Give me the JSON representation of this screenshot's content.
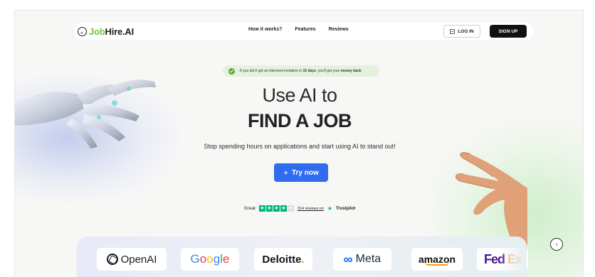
{
  "navbar": {
    "logo_prefix": "Job",
    "logo_suffix": "Hire.AI",
    "links": [
      "How it works?",
      "Features",
      "Reviews"
    ],
    "login_label": "LOG IN",
    "signup_label": "SIGN UP"
  },
  "badge": {
    "text_before": "If you don't get an interview invitation in ",
    "highlight_days": "15 days",
    "text_middle": ", you'll get your ",
    "highlight_money": "money back"
  },
  "hero": {
    "line1": "Use AI to",
    "line2": "FIND A JOB",
    "subtitle": "Stop spending hours on applications and start using AI to stand out!",
    "cta_label": "Try now",
    "cta_icon": "✧"
  },
  "trust": {
    "rating_label": "Great",
    "rating_stars": 4,
    "reviews_link": "314 reviews on",
    "brand": "Trustpilot",
    "colors": {
      "green": "#00b67a"
    }
  },
  "logos": {
    "openai": "OpenAI",
    "google": [
      "G",
      "o",
      "o",
      "g",
      "l",
      "e"
    ],
    "deloitte": "Deloitte",
    "deloitte_dot": ".",
    "meta": "Meta",
    "meta_icon": "∞",
    "amazon": "amazon",
    "fedex_fed": "Fed",
    "fedex_ex": "Ex"
  },
  "scroll_top_icon": "↑",
  "colors": {
    "cta_blue": "#2f6cf0",
    "logo_green": "#7bc043",
    "badge_bg": "#e4f1dc"
  }
}
